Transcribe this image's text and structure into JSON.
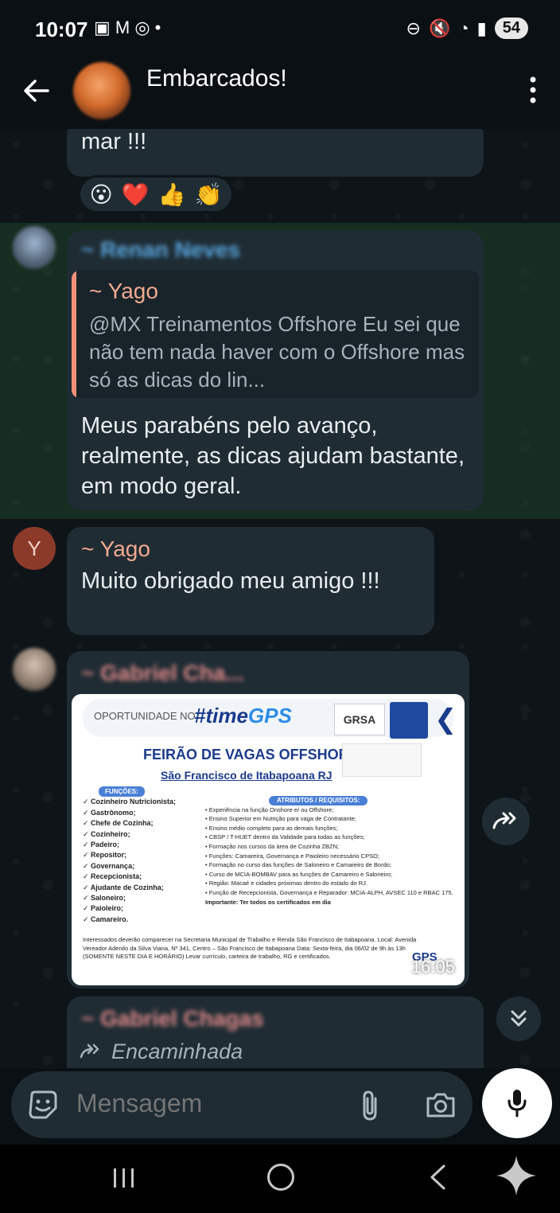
{
  "status_bar": {
    "time": "10:07",
    "left_icons": "▣ M ◎ •",
    "battery": "54"
  },
  "header": {
    "title": "Embarcados!"
  },
  "messages": {
    "m1": {
      "text": "mar !!!",
      "reactions": [
        "😮",
        "❤️",
        "👍",
        "👏"
      ]
    },
    "m2": {
      "sender": "~ Renan Neves",
      "quote_author": "~ Yago",
      "quote_text": "@MX Treinamentos Offshore Eu sei que não tem nada haver com o Offshore mas só as dicas do lin...",
      "text": "Meus parabéns pelo avanço, realmente, as dicas ajudam bastante, em modo geral."
    },
    "m3": {
      "avatar_letter": "Y",
      "sender": "~ Yago",
      "text": "Muito obrigado meu amigo !!!"
    },
    "m4": {
      "sender": "~ Gabriel Cha...",
      "time": "16:05",
      "flyer": {
        "opportunity": "OPORTUNIDADE NO",
        "brand_prefix": "#time",
        "brand_suffix": "GPS",
        "grsa": "GRSA",
        "title": "FEIRÃO DE VAGAS OFFSHORE",
        "subtitle": "São Francisco de Itabapoana RJ",
        "functions_head": "FUNÇÕES:",
        "functions": [
          "Cozinheiro Nutricionista;",
          "Gastrônomo;",
          "Chefe de Cozinha;",
          "Cozinheiro;",
          "Padeiro;",
          "Repositor;",
          "Governança;",
          "Recepcionista;",
          "Ajudante de Cozinha;",
          "Saloneiro;",
          "Paioleiro;",
          "Camareiro."
        ],
        "requirements_head": "ATRIBUTOS / REQUISITOS:",
        "requirements": [
          "Experiência na função Onshore e/ ou Offshore;",
          "Ensino Superior em Nutrição para vaga de Contratante;",
          "Ensino médio completo para as demais funções;",
          "CBSP / T-HUET dentro da Validade para todas as funções;",
          "Formação nos cursos da área de Cozinha ZBZN;",
          "Funções: Camareira, Governança e Paioleiro necessário CPSO;",
          "Formação no curso das funções de Saloneiro e Camareiro de Bordo;",
          "Curso de MCIA-BOMBAV para as funções de Camareiro e Saloneiro;",
          "Região: Macaé e cidades próximas dentro do estado do RJ.",
          "Função de Recepcionista, Governança e Reparador: MCIA-ALPH, AVSEC 110 e RBAC 175."
        ],
        "important": "Importante: Ter todos os certificados em dia",
        "footer": "Interessados deverão comparecer na Secretaria Municipal de Trabalho e Renda São Francisco de Itabapoana. Local: Avenida Vereador Adenilo da Silva Viana, Nº 341, Centro – São Francisco de Itabapoana Data: Sexta-feira, dia 06/02 de 9h às 13h (SOMENTE NESTE DIA E HORÁRIO) Levar currículo, carteira de trabalho, RG e certificados.",
        "gps_logo": "GPS"
      }
    },
    "m5": {
      "sender": "~ Gabriel Chagas",
      "forwarded": "Encaminhada"
    }
  },
  "input": {
    "placeholder": "Mensagem"
  }
}
